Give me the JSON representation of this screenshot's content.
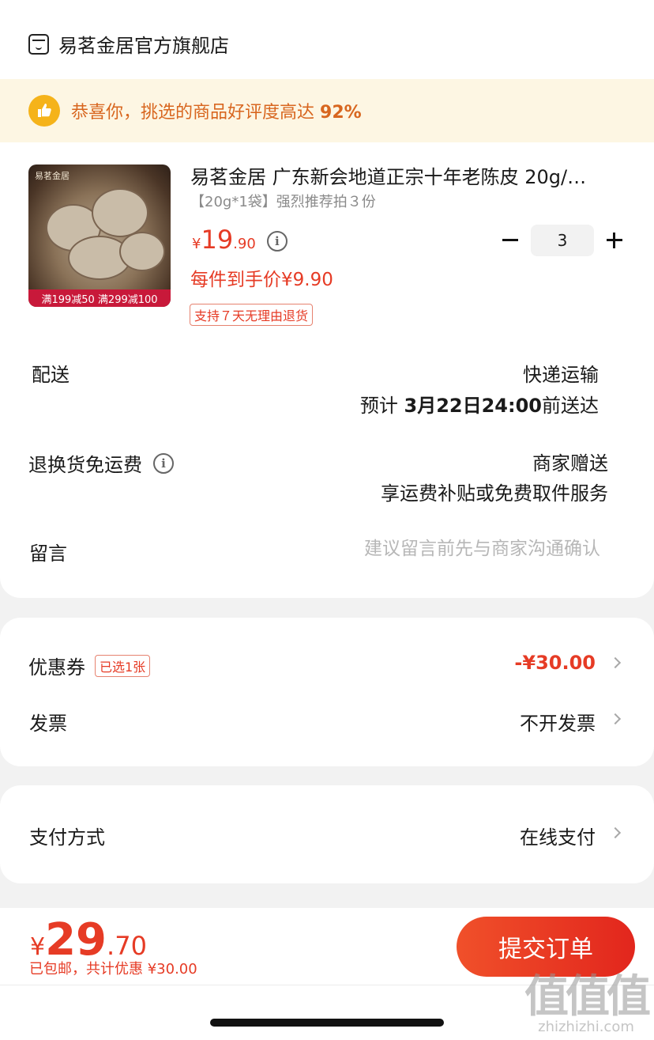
{
  "shop": {
    "name": "易茗金居官方旗舰店",
    "icon": "shop-icon"
  },
  "banner": {
    "text_prefix": "恭喜你，挑选的商品好评度高达",
    "rating": "92%",
    "icon": "thumbs-up-icon"
  },
  "product": {
    "image_brand": "易茗金居",
    "image_promo": "满199减50 满299减100",
    "title": "易茗金居 广东新会地道正宗十年老陈皮 20g/…",
    "sku": "【20g*1袋】强烈推荐拍３份",
    "price_currency": "¥",
    "price_int": "19",
    "price_dec": ".90",
    "each_price": "每件到手价¥9.90",
    "return_tag": "支持７天无理由退货",
    "quantity": "3"
  },
  "delivery": {
    "label": "配送",
    "method": "快递运输",
    "eta_prefix": "预计",
    "eta_date": "3月22日24:00",
    "eta_suffix": "前送达"
  },
  "return_shipping": {
    "label": "退换货免运费",
    "value": "商家赠送",
    "desc": "享运费补贴或免费取件服务"
  },
  "message": {
    "label": "留言",
    "placeholder": "建议留言前先与商家沟通确认",
    "value": ""
  },
  "coupon": {
    "label": "优惠券",
    "badge": "已选1张",
    "value": "-¥30.00"
  },
  "invoice": {
    "label": "发票",
    "value": "不开发票"
  },
  "payment": {
    "label": "支付方式",
    "value": "在线支付"
  },
  "footer": {
    "total_currency": "¥",
    "total_int": "29",
    "total_dec": ".70",
    "note": "已包邮，共计优惠 ¥30.00",
    "submit_label": "提交订单"
  },
  "watermark": {
    "big": "值值值",
    "small": "zhizhizhi.com"
  },
  "colors": {
    "accent": "#e63b25",
    "banner_bg": "#fdf6e3",
    "banner_text": "#d8661f",
    "thumb": "#f5b31a"
  }
}
